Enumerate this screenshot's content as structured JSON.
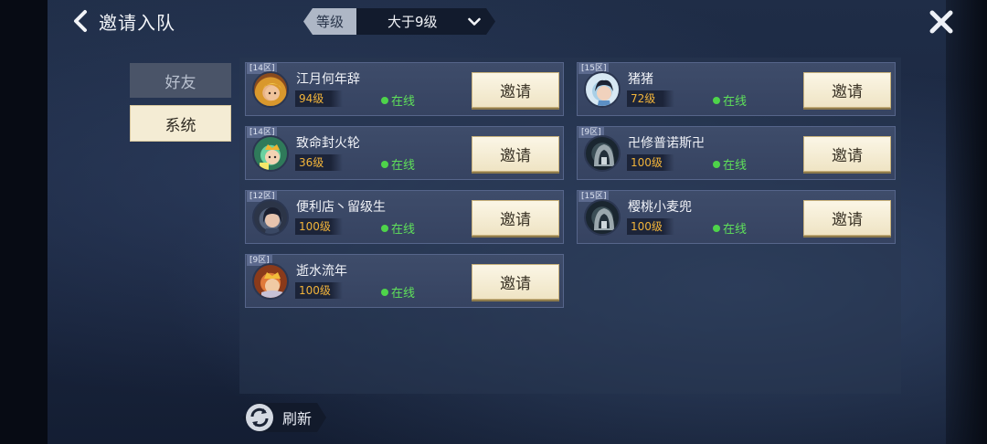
{
  "header": {
    "title": "邀请入队",
    "filter_label": "等级",
    "filter_value": "大于9级"
  },
  "tabs": [
    {
      "label": "好友",
      "selected": false
    },
    {
      "label": "系统",
      "selected": true
    }
  ],
  "invite_label": "邀请",
  "players": [
    {
      "zone": "[14区]",
      "name": "江月何年辞",
      "level": "94级",
      "level_color": "#f2b43a",
      "status": "在线",
      "avatar": "blonde-hero-avatar"
    },
    {
      "zone": "[15区]",
      "name": "猪猪",
      "level": "72级",
      "level_color": "#f2b43a",
      "status": "在线",
      "avatar": "dark-hair-hero-avatar"
    },
    {
      "zone": "[14区]",
      "name": "致命封火轮",
      "level": "36级",
      "level_color": "#f2b43a",
      "status": "在线",
      "avatar": "crowned-hero-avatar"
    },
    {
      "zone": "[9区]",
      "name": "卍修普诺斯卍",
      "level": "100级",
      "level_color": "#f2b43a",
      "status": "在线",
      "avatar": "hooded-figure-avatar"
    },
    {
      "zone": "[12区]",
      "name": "便利店丶留级生",
      "level": "100级",
      "level_color": "#f2b43a",
      "status": "在线",
      "avatar": "dark-hair-girl-avatar"
    },
    {
      "zone": "[15区]",
      "name": "樱桃小麦兜",
      "level": "100级",
      "level_color": "#f2b43a",
      "status": "在线",
      "avatar": "hooded-figure-avatar"
    },
    {
      "zone": "[9区]",
      "name": "逝水流年",
      "level": "100级",
      "level_color": "#f2b43a",
      "status": "在线",
      "avatar": "crowned-warrior-avatar"
    }
  ],
  "footer": {
    "refresh_label": "刷新"
  }
}
